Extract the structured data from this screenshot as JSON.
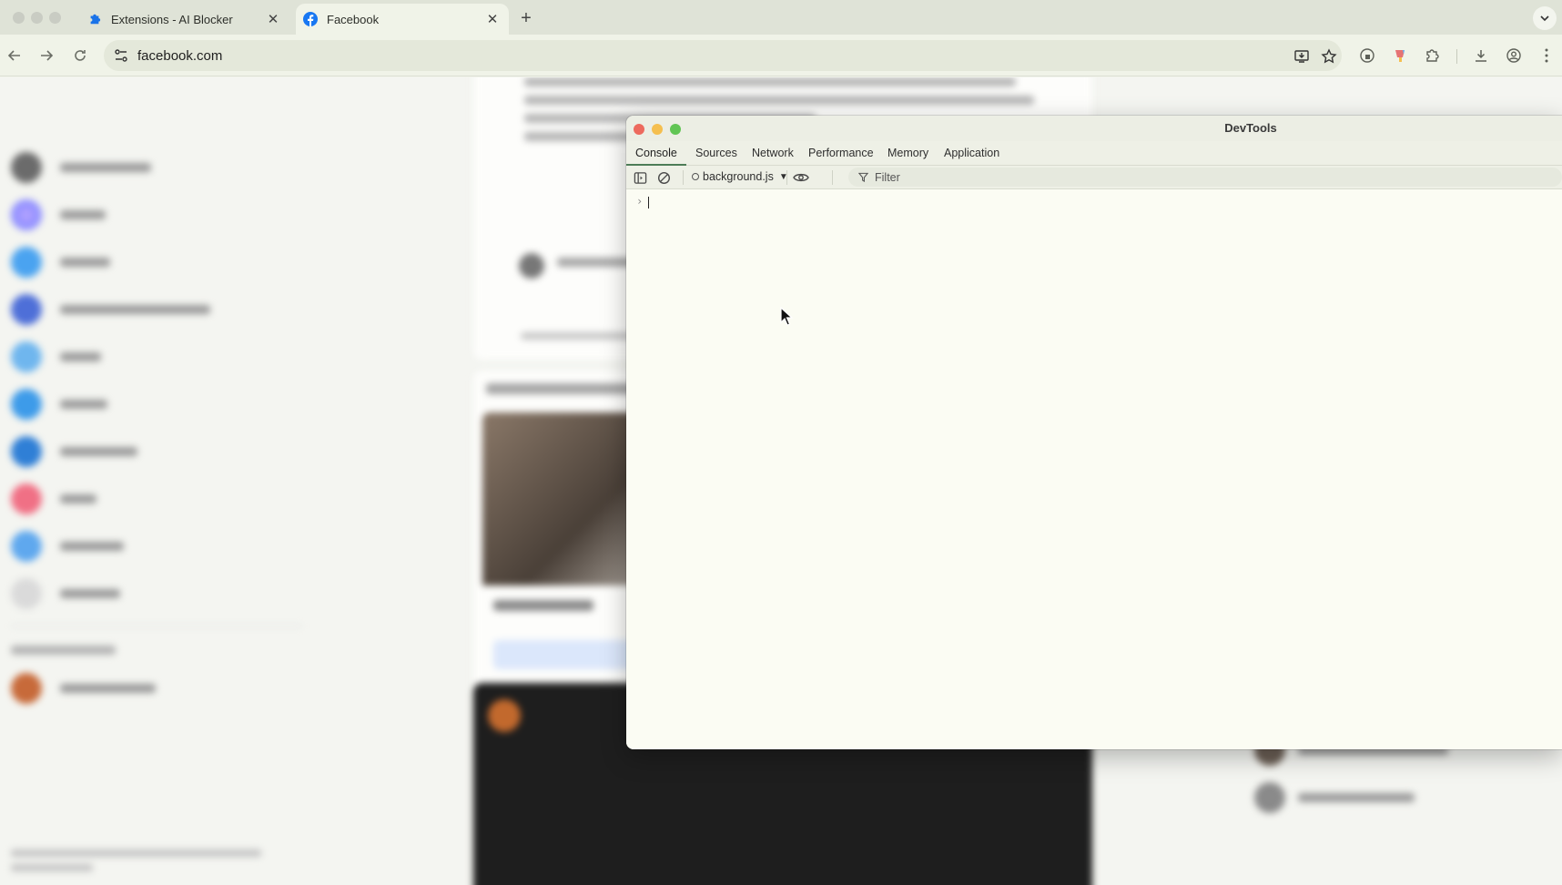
{
  "browser": {
    "tabs": [
      {
        "label": "Extensions - AI Blocker",
        "icon": "puzzle-icon",
        "active": false
      },
      {
        "label": "Facebook",
        "icon": "facebook-icon",
        "active": true
      }
    ],
    "new_tab_label": "+",
    "address": "facebook.com"
  },
  "devtools": {
    "window_title": "DevTools",
    "tabs": [
      "Console",
      "Sources",
      "Network",
      "Performance",
      "Memory",
      "Application"
    ],
    "selected_tab": "Console",
    "context": "background.js",
    "filter_placeholder": "Filter",
    "prompt_symbol": "›"
  },
  "colors": {
    "accent": "#4d7c57",
    "facebook_blue": "#1877f2",
    "close_light": "#ed6a5e",
    "minimize_light": "#f5bf4f",
    "zoom_light": "#61c554"
  }
}
